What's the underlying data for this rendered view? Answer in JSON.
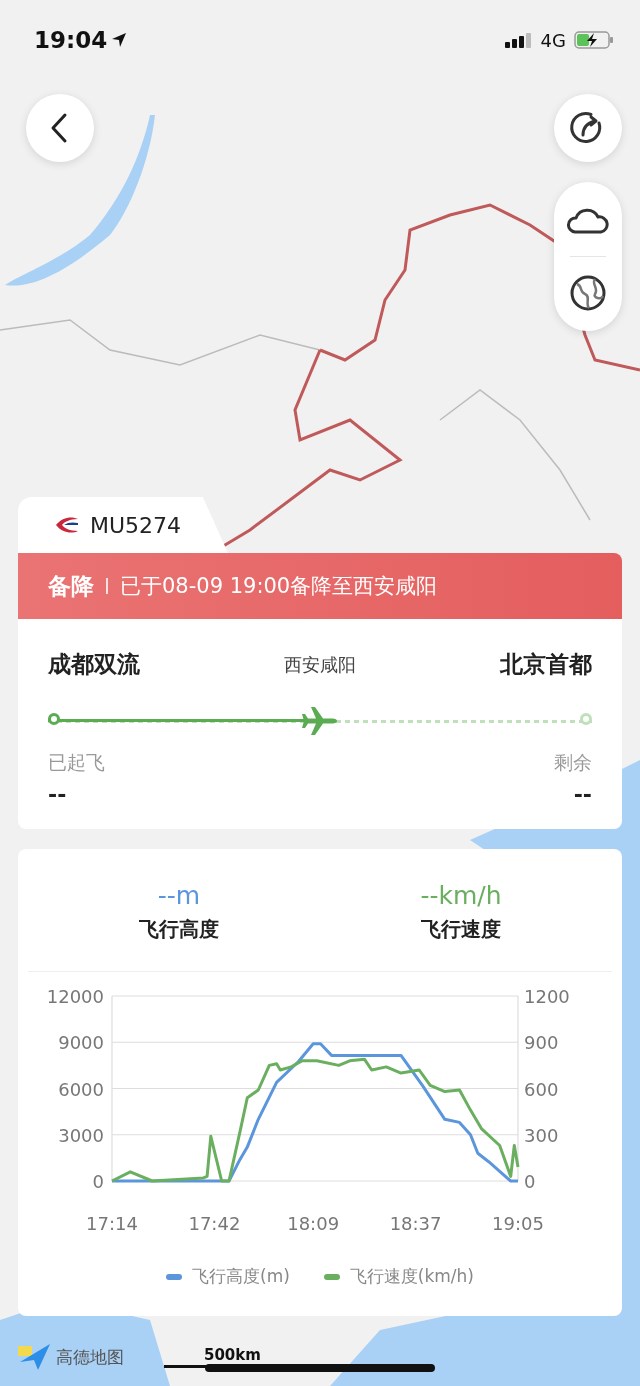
{
  "status_bar": {
    "time": "19:04",
    "network": "4G"
  },
  "flight": {
    "number": "MU5274",
    "alert": {
      "label": "备降",
      "message": "已于08-09 19:00备降至西安咸阳"
    },
    "origin": "成都双流",
    "via": "西安咸阳",
    "destination": "北京首都",
    "progress": {
      "level": 0.5
    },
    "elapsed": {
      "label": "已起飞",
      "value": "--"
    },
    "remaining": {
      "label": "剩余",
      "value": "--"
    }
  },
  "stats": [
    {
      "value": "--m",
      "label": "飞行高度",
      "color": "#5b96dc"
    },
    {
      "value": "--km/h",
      "label": "飞行速度",
      "color": "#6aaf5f"
    }
  ],
  "chart_data": {
    "type": "line",
    "grid": true,
    "xlim": [
      1034,
      1145
    ],
    "ylim": [
      0,
      12000
    ],
    "y2lim": [
      0,
      1200
    ],
    "xticks": [
      {
        "value": 1034,
        "label": "17:14"
      },
      {
        "value": 1062,
        "label": "17:42"
      },
      {
        "value": 1089,
        "label": "18:09"
      },
      {
        "value": 1117,
        "label": "18:37"
      },
      {
        "value": 1145,
        "label": "19:05"
      }
    ],
    "yticks": [
      0,
      3000,
      6000,
      9000,
      12000
    ],
    "y2ticks": [
      0,
      300,
      600,
      900,
      1200
    ],
    "series": [
      {
        "name": "飞行高度(m)",
        "color": "#5b96dc",
        "x": [
          1034,
          1066,
          1069,
          1071,
          1074,
          1079,
          1085,
          1089,
          1091,
          1094,
          1113,
          1119,
          1125,
          1129,
          1132,
          1134,
          1137,
          1143,
          1145
        ],
        "values": [
          0,
          0,
          1400,
          2200,
          4000,
          6400,
          7750,
          8900,
          8900,
          8150,
          8150,
          6150,
          4000,
          3800,
          3000,
          1800,
          1250,
          0,
          0
        ]
      },
      {
        "name": "飞行速度(km/h)",
        "color": "#6aaf5f",
        "axis": "y2",
        "x": [
          1034,
          1039,
          1045,
          1059,
          1060,
          1061,
          1064,
          1066,
          1069,
          1071,
          1074,
          1077,
          1079,
          1080,
          1083,
          1086,
          1090,
          1096,
          1099,
          1103,
          1105,
          1109,
          1113,
          1118,
          1121,
          1125,
          1129,
          1132,
          1135,
          1140,
          1143,
          1144,
          1145
        ],
        "values": [
          0,
          60,
          0,
          20,
          30,
          290,
          0,
          0,
          320,
          540,
          590,
          750,
          760,
          720,
          740,
          780,
          780,
          750,
          780,
          790,
          720,
          740,
          700,
          720,
          620,
          580,
          590,
          460,
          340,
          230,
          30,
          230,
          90
        ]
      }
    ]
  },
  "map": {
    "attribution": "高德地图",
    "scale": "500km"
  }
}
